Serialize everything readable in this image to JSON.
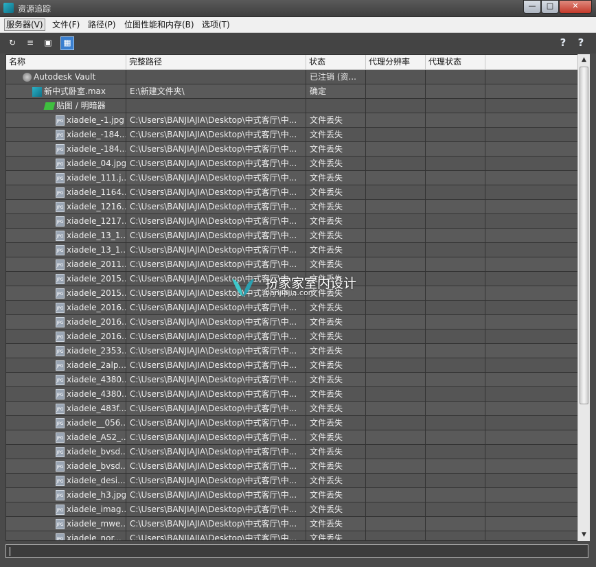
{
  "window": {
    "title": "资源追踪",
    "controls": {
      "minimize": "—",
      "maximize": "□",
      "close": "✕"
    }
  },
  "menu": [
    {
      "label": "服务器(V)",
      "active": true
    },
    {
      "label": "文件(F)"
    },
    {
      "label": "路径(P)"
    },
    {
      "label": "位图性能和内存(B)"
    },
    {
      "label": "选项(T)"
    }
  ],
  "toolbar": {
    "buttons": [
      {
        "name": "refresh-icon",
        "glyph": "↻",
        "selected": false
      },
      {
        "name": "list-view-icon",
        "glyph": "≡",
        "selected": false
      },
      {
        "name": "thumbnail-view-icon",
        "glyph": "▣",
        "selected": false
      },
      {
        "name": "table-view-icon",
        "glyph": "▦",
        "selected": true
      }
    ],
    "help_icons": [
      {
        "name": "help-icon",
        "glyph": "?"
      },
      {
        "name": "context-help-icon",
        "glyph": "?"
      }
    ]
  },
  "table": {
    "columns": [
      "名称",
      "完整路径",
      "状态",
      "代理分辨率",
      "代理状态"
    ],
    "rows": [
      {
        "name": "Autodesk Vault",
        "path": "",
        "status": "已注销 (资...",
        "icon": "vault-icon",
        "indent": 1
      },
      {
        "name": "新中式卧室.max",
        "path": "E:\\新建文件夹\\",
        "status": "确定",
        "icon": "max-file-icon",
        "indent": 2
      },
      {
        "name": "贴图 / 明暗器",
        "path": "",
        "status": "",
        "icon": "bitmap-folder-icon",
        "indent": 3
      },
      {
        "name": "xiadele_-1.jpg",
        "path": "C:\\Users\\BANJIAJIA\\Desktop\\中式客厅\\中...",
        "status": "文件丢失",
        "icon": "jpg-icon",
        "indent": 4
      },
      {
        "name": "xiadele_-184...",
        "path": "C:\\Users\\BANJIAJIA\\Desktop\\中式客厅\\中...",
        "status": "文件丢失",
        "icon": "jpg-icon",
        "indent": 4
      },
      {
        "name": "xiadele_-184...",
        "path": "C:\\Users\\BANJIAJIA\\Desktop\\中式客厅\\中...",
        "status": "文件丢失",
        "icon": "jpg-icon",
        "indent": 4
      },
      {
        "name": "xiadele_04.jpg",
        "path": "C:\\Users\\BANJIAJIA\\Desktop\\中式客厅\\中...",
        "status": "文件丢失",
        "icon": "jpg-icon",
        "indent": 4
      },
      {
        "name": "xiadele_111.j...",
        "path": "C:\\Users\\BANJIAJIA\\Desktop\\中式客厅\\中...",
        "status": "文件丢失",
        "icon": "jpg-icon",
        "indent": 4
      },
      {
        "name": "xiadele_1164...",
        "path": "C:\\Users\\BANJIAJIA\\Desktop\\中式客厅\\中...",
        "status": "文件丢失",
        "icon": "jpg-icon",
        "indent": 4
      },
      {
        "name": "xiadele_1216...",
        "path": "C:\\Users\\BANJIAJIA\\Desktop\\中式客厅\\中...",
        "status": "文件丢失",
        "icon": "jpg-icon",
        "indent": 4
      },
      {
        "name": "xiadele_1217...",
        "path": "C:\\Users\\BANJIAJIA\\Desktop\\中式客厅\\中...",
        "status": "文件丢失",
        "icon": "jpg-icon",
        "indent": 4
      },
      {
        "name": "xiadele_13_1...",
        "path": "C:\\Users\\BANJIAJIA\\Desktop\\中式客厅\\中...",
        "status": "文件丢失",
        "icon": "jpg-icon",
        "indent": 4
      },
      {
        "name": "xiadele_13_1...",
        "path": "C:\\Users\\BANJIAJIA\\Desktop\\中式客厅\\中...",
        "status": "文件丢失",
        "icon": "jpg-icon",
        "indent": 4
      },
      {
        "name": "xiadele_2011...",
        "path": "C:\\Users\\BANJIAJIA\\Desktop\\中式客厅\\中...",
        "status": "文件丢失",
        "icon": "jpg-icon",
        "indent": 4
      },
      {
        "name": "xiadele_2015...",
        "path": "C:\\Users\\BANJIAJIA\\Desktop\\中式客厅\\中...",
        "status": "文件丢失",
        "icon": "jpg-icon",
        "indent": 4
      },
      {
        "name": "xiadele_2015...",
        "path": "C:\\Users\\BANJIAJIA\\Desktop\\中式客厅\\中...",
        "status": "文件丢失",
        "icon": "jpg-icon",
        "indent": 4
      },
      {
        "name": "xiadele_2016...",
        "path": "C:\\Users\\BANJIAJIA\\Desktop\\中式客厅\\中...",
        "status": "文件丢失",
        "icon": "jpg-icon",
        "indent": 4
      },
      {
        "name": "xiadele_2016...",
        "path": "C:\\Users\\BANJIAJIA\\Desktop\\中式客厅\\中...",
        "status": "文件丢失",
        "icon": "jpg-icon",
        "indent": 4
      },
      {
        "name": "xiadele_2016...",
        "path": "C:\\Users\\BANJIAJIA\\Desktop\\中式客厅\\中...",
        "status": "文件丢失",
        "icon": "jpg-icon",
        "indent": 4
      },
      {
        "name": "xiadele_2353...",
        "path": "C:\\Users\\BANJIAJIA\\Desktop\\中式客厅\\中...",
        "status": "文件丢失",
        "icon": "jpg-icon",
        "indent": 4
      },
      {
        "name": "xiadele_2alp...",
        "path": "C:\\Users\\BANJIAJIA\\Desktop\\中式客厅\\中...",
        "status": "文件丢失",
        "icon": "jpg-icon",
        "indent": 4
      },
      {
        "name": "xiadele_4380...",
        "path": "C:\\Users\\BANJIAJIA\\Desktop\\中式客厅\\中...",
        "status": "文件丢失",
        "icon": "jpg-icon",
        "indent": 4
      },
      {
        "name": "xiadele_4380...",
        "path": "C:\\Users\\BANJIAJIA\\Desktop\\中式客厅\\中...",
        "status": "文件丢失",
        "icon": "jpg-icon",
        "indent": 4
      },
      {
        "name": "xiadele_483f...",
        "path": "C:\\Users\\BANJIAJIA\\Desktop\\中式客厅\\中...",
        "status": "文件丢失",
        "icon": "jpg-icon",
        "indent": 4
      },
      {
        "name": "xiadele__056...",
        "path": "C:\\Users\\BANJIAJIA\\Desktop\\中式客厅\\中...",
        "status": "文件丢失",
        "icon": "jpg-icon",
        "indent": 4
      },
      {
        "name": "xiadele_AS2_...",
        "path": "C:\\Users\\BANJIAJIA\\Desktop\\中式客厅\\中...",
        "status": "文件丢失",
        "icon": "jpg-icon",
        "indent": 4
      },
      {
        "name": "xiadele_bvsd...",
        "path": "C:\\Users\\BANJIAJIA\\Desktop\\中式客厅\\中...",
        "status": "文件丢失",
        "icon": "jpg-icon",
        "indent": 4
      },
      {
        "name": "xiadele_bvsd...",
        "path": "C:\\Users\\BANJIAJIA\\Desktop\\中式客厅\\中...",
        "status": "文件丢失",
        "icon": "jpg-icon",
        "indent": 4
      },
      {
        "name": "xiadele_desi...",
        "path": "C:\\Users\\BANJIAJIA\\Desktop\\中式客厅\\中...",
        "status": "文件丢失",
        "icon": "jpg-icon",
        "indent": 4
      },
      {
        "name": "xiadele_h3.jpg",
        "path": "C:\\Users\\BANJIAJIA\\Desktop\\中式客厅\\中...",
        "status": "文件丢失",
        "icon": "jpg-icon",
        "indent": 4
      },
      {
        "name": "xiadele_imag...",
        "path": "C:\\Users\\BANJIAJIA\\Desktop\\中式客厅\\中...",
        "status": "文件丢失",
        "icon": "jpg-icon",
        "indent": 4
      },
      {
        "name": "xiadele_mwe...",
        "path": "C:\\Users\\BANJIAJIA\\Desktop\\中式客厅\\中...",
        "status": "文件丢失",
        "icon": "jpg-icon",
        "indent": 4
      },
      {
        "name": "xiadele_nor...",
        "path": "C:\\Users\\BANJIAJIA\\Desktop\\中式客厅\\中...",
        "status": "文件丢失",
        "icon": "jpg-icon",
        "indent": 4
      }
    ]
  },
  "watermark": {
    "title": "扮家家室内设计",
    "subtitle": "banjiajia.com"
  },
  "colors": {
    "row_bg": "#555555",
    "row_alt_bg": "#5a5a5a",
    "selected_tool": "#3a7fcf"
  }
}
